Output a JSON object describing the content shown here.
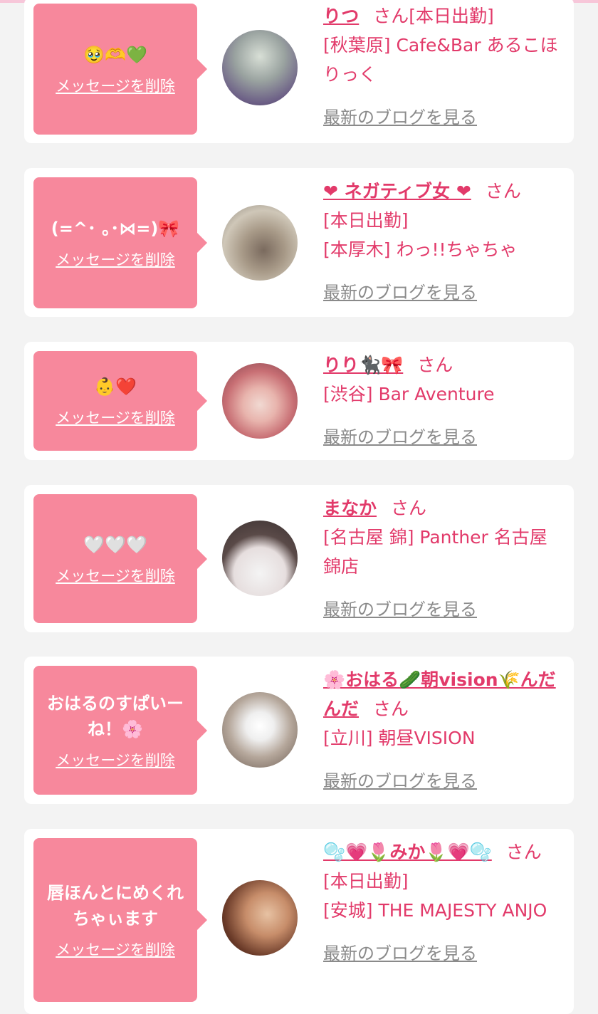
{
  "delete_label": "メッセージを削除",
  "blog_label": "最新のブログを見る",
  "san": "さん",
  "colors": {
    "accent": "#e23a6a",
    "bubble": "#f7889c",
    "link_gray": "#8a8a8a",
    "page_bg": "#f3f3f3"
  },
  "cards": [
    {
      "message": "🥹🫶💚",
      "name": "りつ",
      "lines": [
        "[本日出勤]",
        "[秋葉原] Cafe&Bar あるこほりっく"
      ]
    },
    {
      "message": "(=^･ ｡･⋈=)🎀",
      "name": "❤ ネガティブ女 ❤",
      "lines": [
        "[本日出勤]",
        "[本厚木] わっ!!ちゃちゃ"
      ]
    },
    {
      "message": "👶❤️",
      "name": "りり🐈‍⬛🎀",
      "lines": [
        "[渋谷] Bar Aventure"
      ]
    },
    {
      "message": "🤍🤍🤍",
      "name": "まなか",
      "lines": [
        "[名古屋 錦] Panther 名古屋錦店"
      ]
    },
    {
      "message": "おはるのすぱいーね！🌸",
      "name": "🌸おはる🥒朝vision🌾んだんだ",
      "lines": [
        "[立川] 朝昼VISION"
      ]
    },
    {
      "message": "唇ほんとにめくれちゃぃます",
      "name": "🫧💗🌷みか🌷💗🫧",
      "lines": [
        "[本日出勤]",
        "[安城] THE MAJESTY ANJO"
      ]
    }
  ]
}
